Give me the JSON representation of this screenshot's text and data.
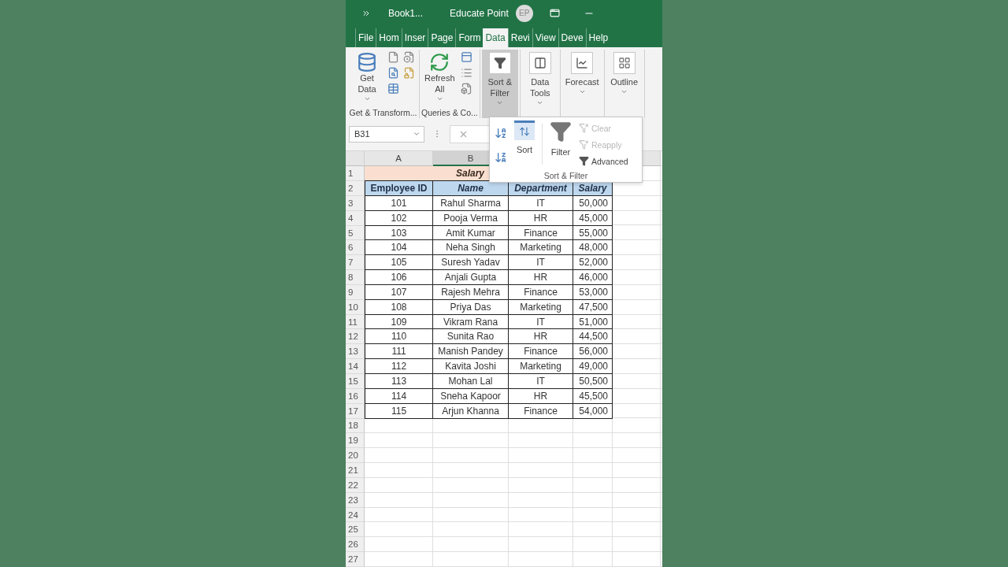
{
  "title_bar": {
    "file_name": "Book1...",
    "account_name": "Educate Point",
    "avatar_initials": "EP"
  },
  "ribbon_tabs": [
    {
      "label": "File",
      "selected": false
    },
    {
      "label": "Hom",
      "selected": false
    },
    {
      "label": "Inser",
      "selected": false
    },
    {
      "label": "Page",
      "selected": false
    },
    {
      "label": "Form",
      "selected": false
    },
    {
      "label": "Data",
      "selected": true
    },
    {
      "label": "Revi",
      "selected": false
    },
    {
      "label": "View",
      "selected": false
    },
    {
      "label": "Deve",
      "selected": false
    },
    {
      "label": "Help",
      "selected": false
    }
  ],
  "ribbon_groups": [
    {
      "label": "Get & Transform...",
      "kind": "get",
      "buttons": [
        {
          "kind": "get-data",
          "lines": [
            "Get",
            "Data"
          ],
          "dropdown": true,
          "selected": false
        }
      ]
    },
    {
      "label": "Queries & Co...",
      "kind": "queries",
      "buttons": [
        {
          "kind": "refresh",
          "lines": [
            "Refresh",
            "All"
          ],
          "dropdown": true,
          "selected": false
        }
      ]
    },
    {
      "buttons": [
        {
          "kind": "sort-filter",
          "lines": [
            "Sort &",
            "Filter"
          ],
          "dropdown": true,
          "selected": true
        }
      ]
    },
    {
      "buttons": [
        {
          "kind": "data-tools",
          "lines": [
            "Data",
            "Tools"
          ],
          "dropdown": true,
          "selected": false
        }
      ]
    },
    {
      "buttons": [
        {
          "kind": "forecast",
          "lines": [
            "Forecast"
          ],
          "dropdown": true,
          "selected": false
        }
      ]
    },
    {
      "buttons": [
        {
          "kind": "outline",
          "lines": [
            "Outline"
          ],
          "dropdown": true,
          "selected": false
        }
      ]
    }
  ],
  "formula_bar": {
    "name_box": "B31"
  },
  "sort_filter_menu": {
    "group_label": "Sort & Filter",
    "commands": [
      {
        "kind": "sort-az",
        "disabled": false
      },
      {
        "kind": "sort-za",
        "disabled": false
      },
      {
        "kind": "sort",
        "label": "Sort",
        "disabled": false
      },
      {
        "kind": "filter",
        "label": "Filter",
        "disabled": false
      },
      {
        "kind": "clear",
        "label": "Clear",
        "disabled": true
      },
      {
        "kind": "reapply",
        "label": "Reapply",
        "disabled": true
      },
      {
        "kind": "advanced",
        "label": "Advanced",
        "disabled": false
      }
    ]
  },
  "sheet": {
    "column_headers": [
      {
        "label": "A",
        "selected": false
      },
      {
        "label": "B",
        "selected": true
      }
    ],
    "row_numbers": [
      "1",
      "2",
      "3",
      "4",
      "5",
      "6",
      "7",
      "8",
      "9",
      "10",
      "11",
      "12",
      "13",
      "14",
      "15",
      "16",
      "17",
      "18",
      "19",
      "20",
      "21",
      "22",
      "23",
      "24",
      "25",
      "26",
      "27"
    ],
    "title": "Salary",
    "header_row": [
      {
        "text": "Employee ID",
        "italic": false
      },
      {
        "text": "Name",
        "italic": true
      },
      {
        "text": "Department",
        "italic": true
      },
      {
        "text": "Salary",
        "italic": true
      }
    ],
    "rows": [
      [
        "101",
        "Rahul Sharma",
        "IT",
        "50,000"
      ],
      [
        "102",
        "Pooja Verma",
        "HR",
        "45,000"
      ],
      [
        "103",
        "Amit Kumar",
        "Finance",
        "55,000"
      ],
      [
        "104",
        "Neha Singh",
        "Marketing",
        "48,000"
      ],
      [
        "105",
        "Suresh Yadav",
        "IT",
        "52,000"
      ],
      [
        "106",
        "Anjali Gupta",
        "HR",
        "46,000"
      ],
      [
        "107",
        "Rajesh Mehra",
        "Finance",
        "53,000"
      ],
      [
        "108",
        "Priya Das",
        "Marketing",
        "47,500"
      ],
      [
        "109",
        "Vikram Rana",
        "IT",
        "51,000"
      ],
      [
        "110",
        "Sunita Rao",
        "HR",
        "44,500"
      ],
      [
        "111",
        "Manish Pandey",
        "Finance",
        "56,000"
      ],
      [
        "112",
        "Kavita Joshi",
        "Marketing",
        "49,000"
      ],
      [
        "113",
        "Mohan Lal",
        "IT",
        "50,500"
      ],
      [
        "114",
        "Sneha Kapoor",
        "HR",
        "45,500"
      ],
      [
        "115",
        "Arjun Khanna",
        "Finance",
        "54,000"
      ]
    ]
  }
}
